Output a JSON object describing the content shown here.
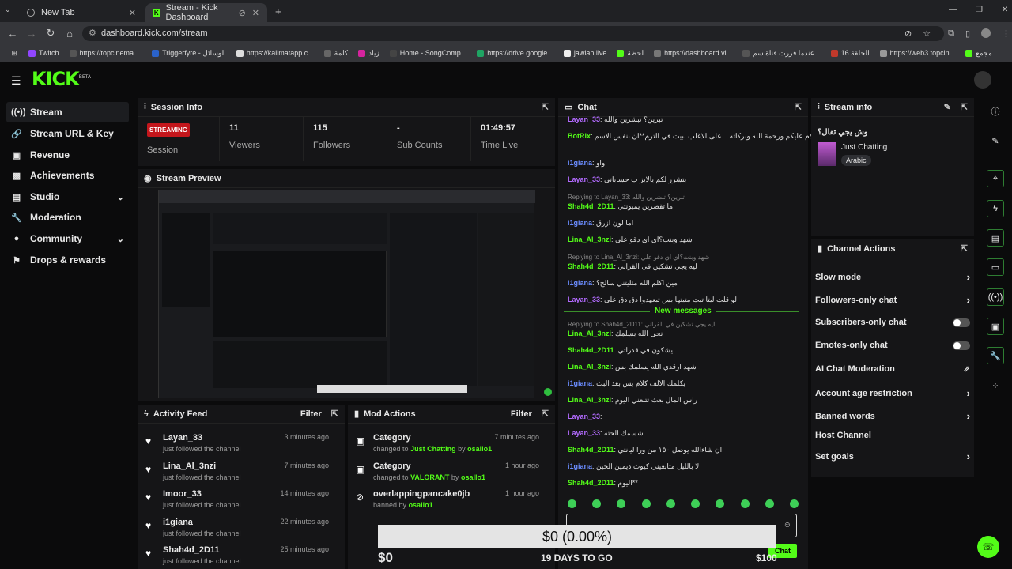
{
  "browser": {
    "tabs": [
      {
        "label": "New Tab"
      },
      {
        "label": "Stream - Kick Dashboard"
      }
    ],
    "url": "dashboard.kick.com/stream",
    "bookmarks": [
      "Twitch",
      "https://topcinema....",
      "Triggerfyre - الوسائل",
      "https://kalimatapp.c...",
      "كلمة",
      "زياد",
      "Home - SongComp...",
      "https://drive.google...",
      "jawlah.live",
      "لحظة",
      "https://dashboard.vi...",
      "عندما قررت قناة سم...",
      "الحلقة 16",
      "https://web3.topcin...",
      "مجمع"
    ]
  },
  "brand": {
    "logo": "KICK",
    "beta": "BETA"
  },
  "sidebar": {
    "items": [
      {
        "label": "Stream",
        "icon": "radio-icon"
      },
      {
        "label": "Stream URL & Key",
        "icon": "link-icon"
      },
      {
        "label": "Revenue",
        "icon": "revenue-icon"
      },
      {
        "label": "Achievements",
        "icon": "trophy-icon"
      },
      {
        "label": "Studio",
        "icon": "studio-icon"
      },
      {
        "label": "Moderation",
        "icon": "wrench-icon"
      },
      {
        "label": "Community",
        "icon": "community-icon"
      },
      {
        "label": "Drops & rewards",
        "icon": "gift-icon"
      }
    ]
  },
  "session": {
    "title": "Session Info",
    "badge": "STREAMING",
    "badge_label": "Session",
    "stats": [
      {
        "value": "11",
        "label": "Viewers"
      },
      {
        "value": "115",
        "label": "Followers"
      },
      {
        "value": "-",
        "label": "Sub Counts"
      },
      {
        "value": "01:49:57",
        "label": "Time Live"
      }
    ]
  },
  "preview": {
    "title": "Stream Preview"
  },
  "activity": {
    "title": "Activity Feed",
    "filter": "Filter",
    "items": [
      {
        "name": "Layan_33",
        "sub": "just followed the channel",
        "time": "3 minutes ago"
      },
      {
        "name": "Lina_Al_3nzi",
        "sub": "just followed the channel",
        "time": "7 minutes ago"
      },
      {
        "name": "Imoor_33",
        "sub": "just followed the channel",
        "time": "14 minutes ago"
      },
      {
        "name": "i1giana",
        "sub": "just followed the channel",
        "time": "22 minutes ago"
      },
      {
        "name": "Shah4d_2D11",
        "sub": "just followed the channel",
        "time": "25 minutes ago"
      }
    ]
  },
  "modactions": {
    "title": "Mod Actions",
    "filter": "Filter",
    "items": [
      {
        "title": "Category",
        "pre": "changed to",
        "target": "Just Chatting",
        "by": "by",
        "mod": "osallo1",
        "time": "7 minutes ago"
      },
      {
        "title": "Category",
        "pre": "changed to",
        "target": "VALORANT",
        "by": "by",
        "mod": "osallo1",
        "time": "1 hour ago"
      },
      {
        "title": "overlappingpancake0jb",
        "pre": "banned by",
        "target": "",
        "by": "",
        "mod": "osallo1",
        "time": "1 hour ago"
      }
    ]
  },
  "chat": {
    "title": "Chat",
    "new_messages": "New messages",
    "send": "Chat",
    "messages": [
      {
        "user": "Layan_33",
        "text": "تبرين؟ تبشرين والله",
        "color": "#b36bff"
      },
      {
        "user": "BotRix",
        "text": "سلام عليكم ورحمة الله وبركاته .. على الاغلب نبيت في الترم**ان بنفس الاسم",
        "color": "#53fc18"
      },
      {
        "user": "i1giana",
        "text": "واو",
        "color": "#6b8cff"
      },
      {
        "user": "Layan_33",
        "text": "بتشرر لكم يالايز ب حساباتي",
        "color": "#b36bff"
      },
      {
        "reply": "Replying to Layan_33: تبرين؟ تبشرين والله"
      },
      {
        "user": "Shah4d_2D11",
        "text": "ما تقصرين يميونتي",
        "color": "#53fc18"
      },
      {
        "user": "i1giana",
        "text": "اما لون ازرق",
        "color": "#6b8cff"
      },
      {
        "user": "Lina_Al_3nzi",
        "text": "شهد وبنت؟اي اي دقو علي",
        "color": "#53fc18"
      },
      {
        "reply": "Replying to Lina_Al_3nzi: شهد وبنت؟اي اي دقو علي"
      },
      {
        "user": "Shah4d_2D11",
        "text": "ليه يجي تشكين في القراني",
        "color": "#53fc18"
      },
      {
        "user": "i1giana",
        "text": "مين اكلم الله مثليتني سالح؟",
        "color": "#6b8cff"
      },
      {
        "user": "Layan_33",
        "text": "لو قلت ليتا تبت متيتها بس تبعهدوا دق دق على",
        "color": "#b36bff"
      },
      {
        "reply": "Replying to Shah4d_2D11: ليه يجي تشكين في القراني"
      },
      {
        "user": "Lina_Al_3nzi",
        "text": "تحي الله يسلمك",
        "color": "#53fc18"
      },
      {
        "user": "Shah4d_2D11",
        "text": "يشكون في قدراتي",
        "color": "#53fc18"
      },
      {
        "user": "Lina_Al_3nzi",
        "text": "شهد ارقدي الله يسلمك بس",
        "color": "#53fc18"
      },
      {
        "user": "i1giana",
        "text": "يكلمك الالف كلام بس بعد البث",
        "color": "#6b8cff"
      },
      {
        "user": "Lina_Al_3nzi",
        "text": "راس المال بعث تتبعني اليوم",
        "color": "#53fc18"
      },
      {
        "user": "Layan_33",
        "text": "",
        "color": "#b36bff"
      },
      {
        "user": "Layan_33",
        "text": "شسمك الحته",
        "color": "#b36bff"
      },
      {
        "user": "Shah4d_2D11",
        "text": "ان شاءالله يوصل ١٥٠ من ورا ليانتي",
        "color": "#53fc18"
      },
      {
        "user": "i1giana",
        "text": "لا بالليل متابعيني كيوت ديمين الحين",
        "color": "#6b8cff"
      },
      {
        "user": "Shah4d_2D11",
        "text": "اليوم**",
        "color": "#53fc18"
      }
    ]
  },
  "streaminfo": {
    "title": "Stream info",
    "stream_title": "وش يجي تقال؟",
    "category": "Just Chatting",
    "language": "Arabic"
  },
  "channel_actions": {
    "title": "Channel Actions",
    "items": [
      {
        "label": "Slow mode",
        "type": "chevron"
      },
      {
        "label": "Followers-only chat",
        "type": "chevron"
      },
      {
        "label": "Subscribers-only chat",
        "type": "toggle"
      },
      {
        "label": "Emotes-only chat",
        "type": "toggle"
      },
      {
        "label": "AI Chat Moderation",
        "type": "external"
      },
      {
        "label": "Account age restriction",
        "type": "chevron"
      },
      {
        "label": "Banned words",
        "type": "chevron"
      },
      {
        "label": "Host Channel",
        "type": "none"
      },
      {
        "label": "Set goals",
        "type": "chevron"
      }
    ]
  },
  "goal": {
    "text": "$0 (0.00%)",
    "start": "$0",
    "days": "19 DAYS TO GO",
    "end": "$100",
    "progress": 0
  },
  "colors": {
    "accent": "#53fc18",
    "streaming": "#c4161c"
  }
}
